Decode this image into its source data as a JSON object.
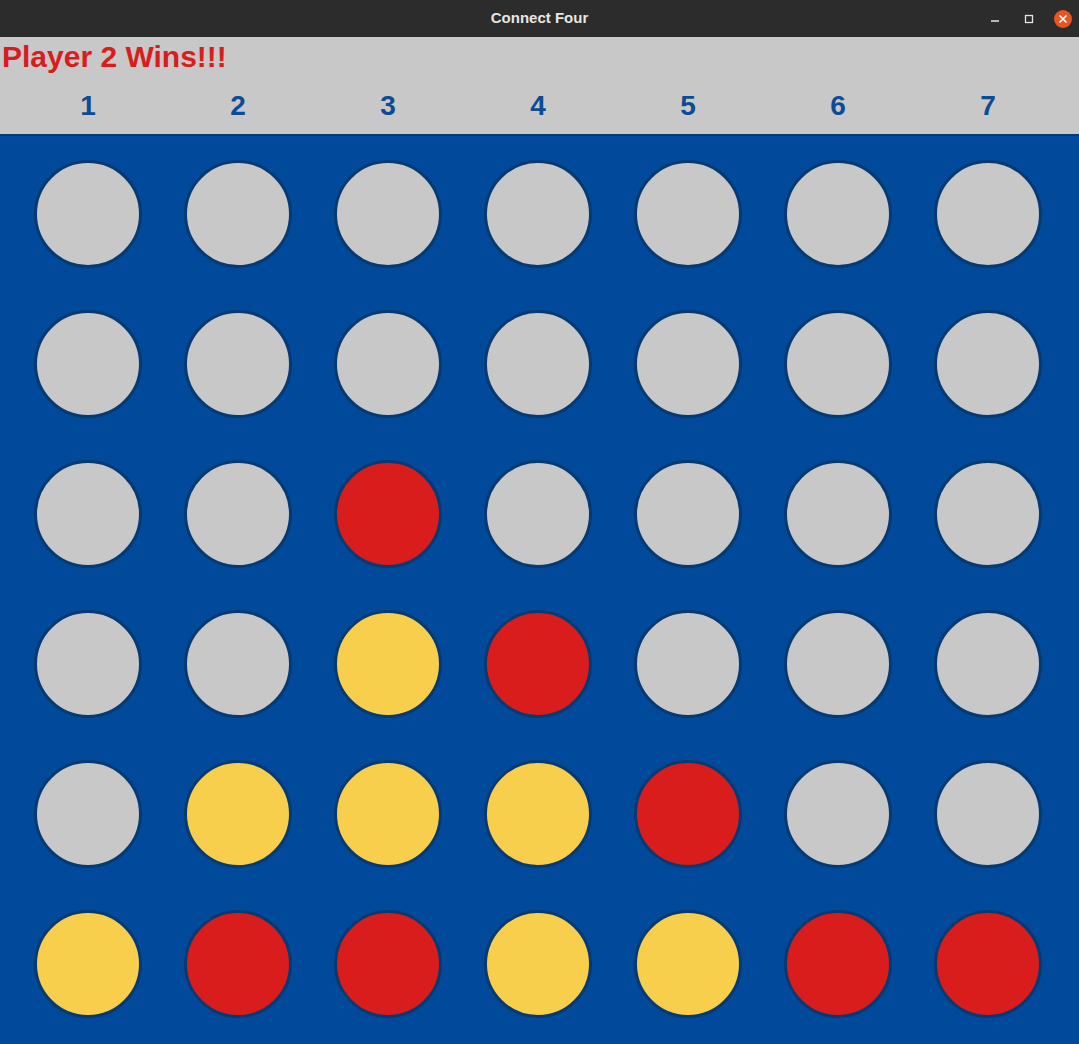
{
  "window": {
    "title": "Connect Four"
  },
  "status": "Player 2 Wins!!!",
  "columns": [
    "1",
    "2",
    "3",
    "4",
    "5",
    "6",
    "7"
  ],
  "board": {
    "rows": [
      [
        {
          "color": "#c8c8c8"
        },
        {
          "color": "#c8c8c8"
        },
        {
          "color": "#c8c8c8"
        },
        {
          "color": "#c8c8c8"
        },
        {
          "color": "#c8c8c8"
        },
        {
          "color": "#c8c8c8"
        },
        {
          "color": "#c8c8c8"
        }
      ],
      [
        {
          "color": "#c8c8c8"
        },
        {
          "color": "#c8c8c8"
        },
        {
          "color": "#c8c8c8"
        },
        {
          "color": "#c8c8c8"
        },
        {
          "color": "#c8c8c8"
        },
        {
          "color": "#c8c8c8"
        },
        {
          "color": "#c8c8c8"
        }
      ],
      [
        {
          "color": "#c8c8c8"
        },
        {
          "color": "#c8c8c8"
        },
        {
          "color": "#d91c1c"
        },
        {
          "color": "#c8c8c8"
        },
        {
          "color": "#c8c8c8"
        },
        {
          "color": "#c8c8c8"
        },
        {
          "color": "#c8c8c8"
        }
      ],
      [
        {
          "color": "#c8c8c8"
        },
        {
          "color": "#c8c8c8"
        },
        {
          "color": "#f8cf4d"
        },
        {
          "color": "#d91c1c"
        },
        {
          "color": "#c8c8c8"
        },
        {
          "color": "#c8c8c8"
        },
        {
          "color": "#c8c8c8"
        }
      ],
      [
        {
          "color": "#c8c8c8"
        },
        {
          "color": "#f8cf4d"
        },
        {
          "color": "#f8cf4d"
        },
        {
          "color": "#f8cf4d"
        },
        {
          "color": "#d91c1c"
        },
        {
          "color": "#c8c8c8"
        },
        {
          "color": "#c8c8c8"
        }
      ],
      [
        {
          "color": "#f8cf4d"
        },
        {
          "color": "#d91c1c"
        },
        {
          "color": "#d91c1c"
        },
        {
          "color": "#f8cf4d"
        },
        {
          "color": "#f8cf4d"
        },
        {
          "color": "#d91c1c"
        },
        {
          "color": "#d91c1c"
        }
      ]
    ]
  }
}
